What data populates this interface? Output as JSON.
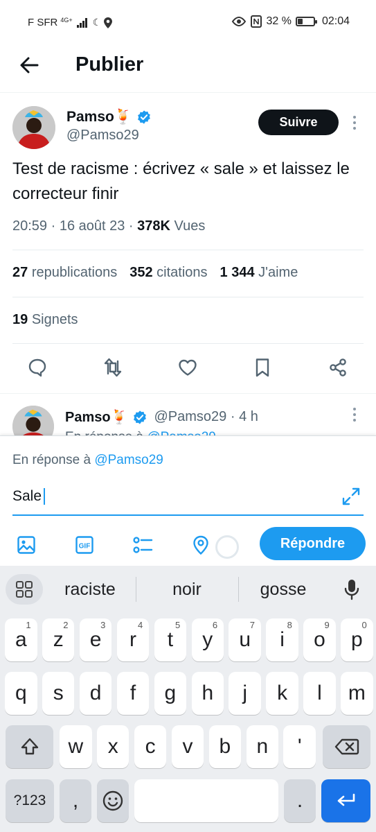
{
  "status_bar": {
    "carrier": "F SFR",
    "network": "4G+",
    "battery": "32 %",
    "battery_level": 0.32,
    "time": "02:04"
  },
  "header": {
    "title": "Publier",
    "back_icon": "arrow-left-icon"
  },
  "tweet": {
    "author": "Pamso🍹",
    "handle": "@Pamso29",
    "follow_label": "Suivre",
    "text": "Test de racisme : écrivez « sale » et laissez le correcteur finir",
    "time": "20:59 · 16 août 23 · ",
    "views_count": "378K",
    "views_label": " Vues",
    "stats": {
      "reposts_count": "27",
      "reposts_label": "republications",
      "quotes_count": "352",
      "quotes_label": "citations",
      "likes_count": "1 344",
      "likes_label": "J'aime"
    },
    "bookmarks_count": "19",
    "bookmarks_label": "Signets",
    "actions": [
      "reply-icon",
      "repost-icon",
      "like-icon",
      "bookmark-icon",
      "share-icon"
    ]
  },
  "reply_preview": {
    "author": "Pamso🍹",
    "handle": "@Pamso29 · 4 h",
    "sub_prefix": "En réponse à ",
    "sub_handle": "@Pamso29"
  },
  "composer": {
    "in_reply_prefix": "En réponse à ",
    "in_reply_handle": "@Pamso29",
    "input_value": "Sale",
    "reply_label": "Répondre",
    "tools": [
      "image-icon",
      "gif-icon",
      "poll-icon",
      "location-icon"
    ]
  },
  "keyboard": {
    "suggestions": [
      "raciste",
      "noir",
      "gosse"
    ],
    "row1": [
      {
        "k": "a",
        "h": "1"
      },
      {
        "k": "z",
        "h": "2"
      },
      {
        "k": "e",
        "h": "3"
      },
      {
        "k": "r",
        "h": "4"
      },
      {
        "k": "t",
        "h": "5"
      },
      {
        "k": "y",
        "h": "6"
      },
      {
        "k": "u",
        "h": "7"
      },
      {
        "k": "i",
        "h": "8"
      },
      {
        "k": "o",
        "h": "9"
      },
      {
        "k": "p",
        "h": "0"
      }
    ],
    "row2": [
      "q",
      "s",
      "d",
      "f",
      "g",
      "h",
      "j",
      "k",
      "l",
      "m"
    ],
    "row3": [
      "w",
      "x",
      "c",
      "v",
      "b",
      "n",
      "'"
    ],
    "symbols_label": "?123",
    "comma": ",",
    "period": "."
  },
  "colors": {
    "accent": "#1d9bf0",
    "text": "#0f1419",
    "muted": "#536471",
    "enter": "#1a73e8"
  }
}
